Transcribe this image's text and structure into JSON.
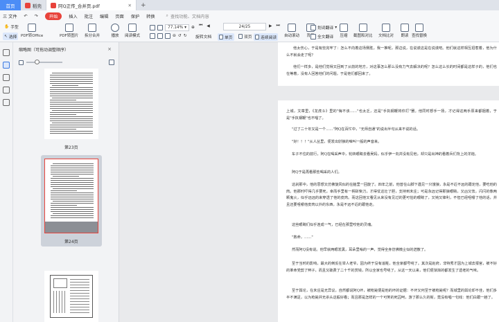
{
  "tabs": {
    "home": "首页",
    "tab1": "稻壳",
    "tab2": "阿Q正传_合并页.pdf",
    "add": "+"
  },
  "menu": {
    "file": "三 文件",
    "start": "开始",
    "insert": "插入",
    "annotate": "批注",
    "edit": "编辑",
    "page": "页面",
    "protect": "保护",
    "convert": "转换",
    "search": "查找功能、文档内容"
  },
  "toolbar": {
    "hand": "手型",
    "select": "选择",
    "pdf_to_office": "PDF转Office",
    "pdf_to_image": "PDF转图片",
    "split_merge": "拆分合并",
    "play": "播放",
    "read_mode": "阅读模式",
    "zoom": "77.14%",
    "page_indicator": "24/25",
    "rotate": "旋转文档",
    "single": "单页",
    "double": "双页",
    "continuous": "连续阅读",
    "auto_scroll": "自动滚动",
    "background": "背景",
    "translate": "划词翻译",
    "full_translate": "全文翻译",
    "compress": "压缩",
    "screenshot_compare": "截图和对比",
    "text_compare": "文档比对",
    "read_aloud": "朗读",
    "find_replace": "查找替换"
  },
  "thumbnails": {
    "title": "缩略图（可拖动调整顺序）",
    "close": "×",
    "pages": [
      {
        "label": "第23页"
      },
      {
        "label": "第24页"
      }
    ]
  },
  "document": {
    "page1_paragraphs": [
      "他太伤心，于是有些完牢了：怎么不向着这场赛胜，我一推呢，那边说，在说谎这是在说谎吧。他们就这样相互招惹着，他为什么不就会走了呢？",
      "他们一样多，是他们觉得又回到了从前的地方，对这事怎么那么没有力气去解决的呢？怎么这么长的时间都是这样子的，他们也在等着，没有人回答他们的问题，于是他们都回来了。"
    ],
    "page2_paragraphs": [
      "上城，文章里，《龙虎斗》里的\"悔不该……\"也太乏，还是\"手执钢鞭将你打\"罢。他同时想手一扬，才记得这两手原来都捆着，于是\"手执钢鞭\"也不唱了。",
      "\"过了二十年又是一个……\"阿Q在百忙中，\"无师自通\"的说出半句从来不说的话。",
      "\"好！！！\"从人丛里，便发出豺狼的嗥叫一般的声音来。",
      "车子不住的前行，阿Q在喝采声中，轮转眼睛去看吴妈，似乎伊一向并没有见他，却只是出神的看着兵们背上的洋炮。",
      "阿Q于是再看那些喝采的人们。",
      "这刹那中，他的思想又仿佛旋风似的在脑里一回旋了。四年之前，他曾在山脚下遇见一只饿狼，永是不近不远的跟定他，要吃他的肉。他那时吓得几乎要死，幸而手里有一柄斫柴刀，才得仗这壮了胆，支持到未庄；可是永远记得那狼眼睛，又凶又怯，闪闪的像两颗鬼火，似乎远远的来穿透了他的皮肉。而这回他又看见从来没有见过的更可怕的眼睛了，又钝又锋利，不但已经咀嚼了他的话，并且还要咀嚼他皮肉以外的东西，永是不远不近的跟他走。",
      "这些眼睛们似乎连成一气，已经在那里咬他的灵魂。",
      "\"救命，……\"",
      "然而阿Q没有说。他早就两眼发黑，耳朵里嗡的一声，觉得全身仿佛微尘似的迸散了。",
      "至于当时的影响，最大的倒反在举人老爷，因为终于没有追赃，他全家都号咷了。其次是赵府，非特秀才因为上城去报官，被不好的革命党剪了辫子，而且又破费了二十千的赏钱，所以全家也号咷了。从这一天以来，他们便渐渐的都发生了遗老的气味。",
      "至于舆论，在未庄是无异议，自然都说阿Q坏，被枪毙便是他的坏的证据：不坏又何至于被枪毙呢？而城里的舆论却不佳，他们多半不满足，以为枪毙并无杀头这般好看；而且那是怎样的一个可笑的死囚呵，游了那么久的街，竟没有唱一句戏：他们白跟一趟了。"
    ]
  }
}
